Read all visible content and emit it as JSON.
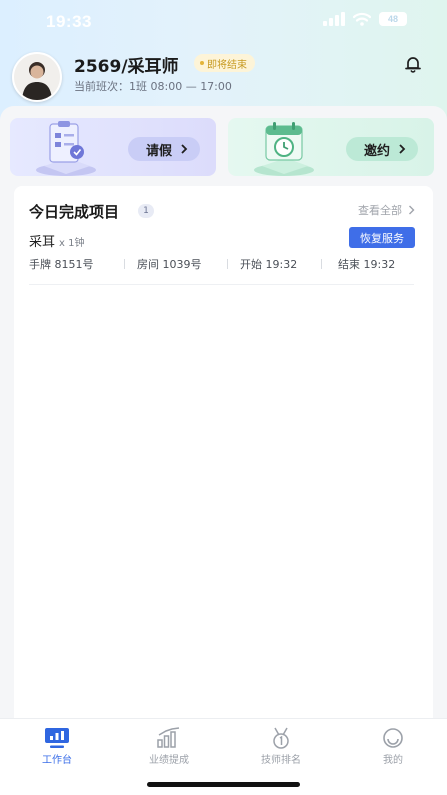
{
  "status_bar": {
    "time": "19:33",
    "battery": "48"
  },
  "header": {
    "user_name": "2569/采耳师",
    "status_badge": "即将结束",
    "shift": "当前班次：1班 08:00 — 17:00"
  },
  "action_cards": {
    "leave_label": "请假",
    "invite_label": "邀约"
  },
  "completed": {
    "title": "今日完成项目",
    "count": "1",
    "view_all": "查看全部",
    "items": [
      {
        "name": "采耳",
        "qty": "x 1钟",
        "action": "恢复服务",
        "tag": "手牌 8151号",
        "room": "房间 1039号",
        "start": "开始 19:32",
        "end": "结束 19:32"
      }
    ]
  },
  "tabs": [
    {
      "label": "工作台",
      "icon": "monitor-icon",
      "active": true
    },
    {
      "label": "业绩提成",
      "icon": "bar-chart-icon",
      "active": false
    },
    {
      "label": "技师排名",
      "icon": "medal-icon",
      "active": false
    },
    {
      "label": "我的",
      "icon": "smile-icon",
      "active": false
    }
  ],
  "colors": {
    "accent": "#3f6ee8",
    "badge_text": "#c79a22",
    "leave_card": "#dcdcfb",
    "invite_card": "#d8f3e8"
  }
}
